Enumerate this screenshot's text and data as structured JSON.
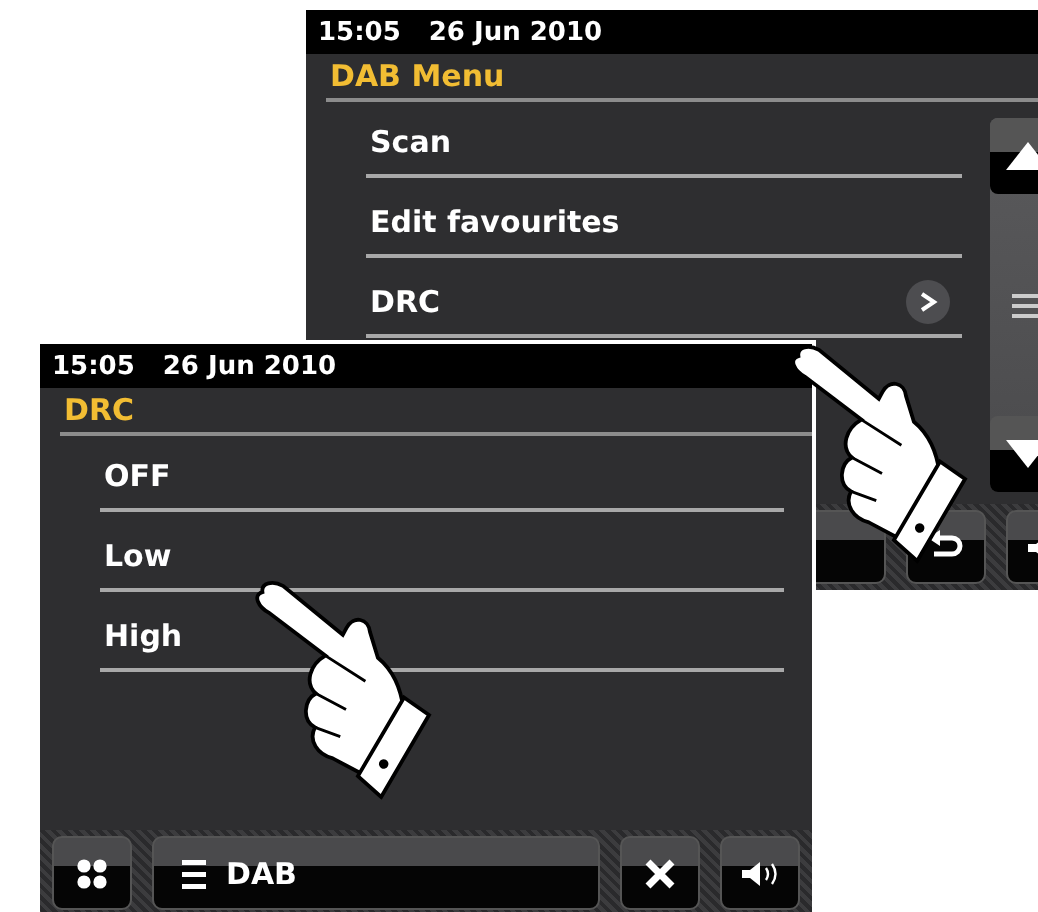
{
  "screens": [
    {
      "status": {
        "time": "15:05",
        "date": "26 Jun 2010"
      },
      "title": "DAB Menu",
      "scrollbar": true,
      "items": [
        {
          "label": "Scan",
          "kind": "action"
        },
        {
          "label": "Edit favourites",
          "kind": "action"
        },
        {
          "label": "DRC",
          "kind": "submenu"
        }
      ],
      "bottom_bar": [
        {
          "kind": "source"
        },
        {
          "kind": "back"
        },
        {
          "kind": "volume"
        }
      ]
    },
    {
      "status": {
        "time": "15:05",
        "date": "26 Jun 2010"
      },
      "title": "DRC",
      "scrollbar": false,
      "items": [
        {
          "label": "OFF",
          "kind": "option"
        },
        {
          "label": "Low",
          "kind": "option"
        },
        {
          "label": "High",
          "kind": "option"
        }
      ],
      "bottom_bar": [
        {
          "kind": "home"
        },
        {
          "kind": "source",
          "label": "DAB"
        },
        {
          "kind": "close"
        },
        {
          "kind": "volume"
        }
      ]
    }
  ]
}
